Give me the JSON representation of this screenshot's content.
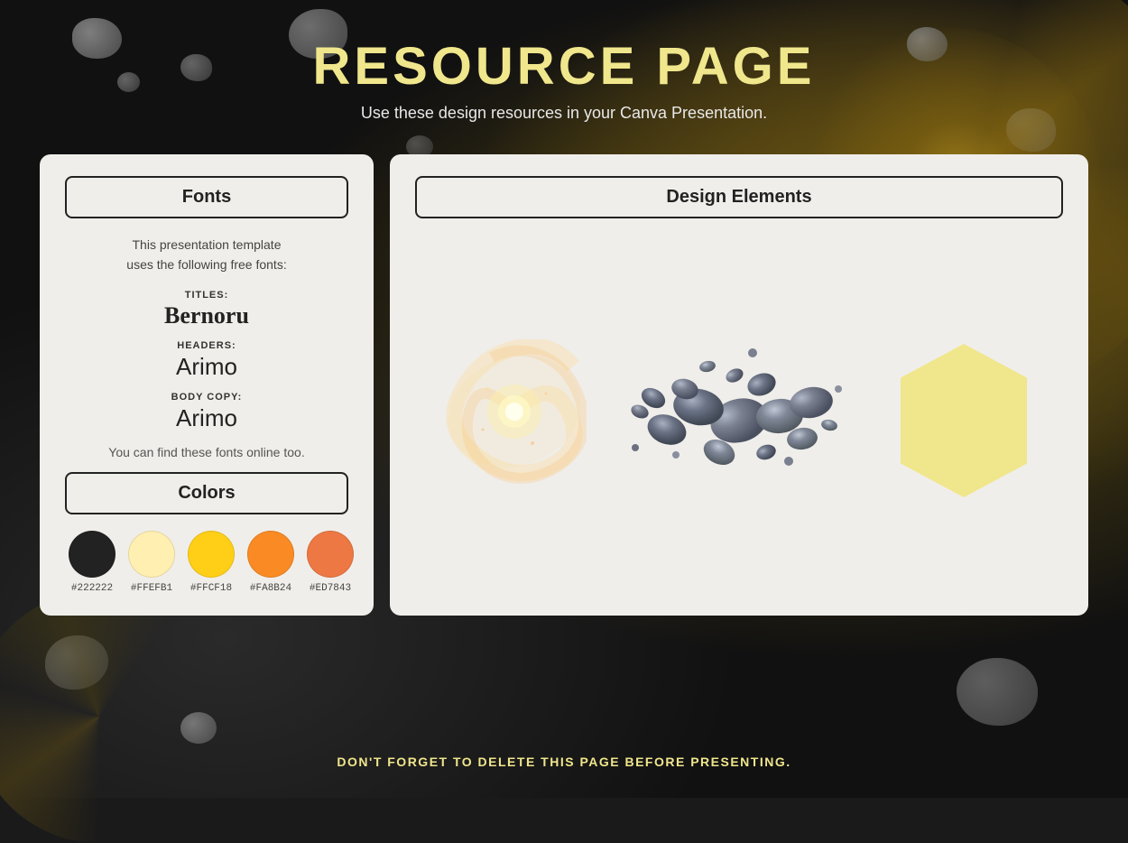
{
  "page": {
    "title": "RESOURCE PAGE",
    "subtitle": "Use these design resources in your Canva Presentation.",
    "footer": "DON'T FORGET TO DELETE THIS PAGE BEFORE PRESENTING."
  },
  "fonts_section": {
    "header": "Fonts",
    "intro_line1": "This presentation template",
    "intro_line2": "uses the following free fonts:",
    "titles_label": "TITLES:",
    "titles_font": "Bernoru",
    "headers_label": "HEADERS:",
    "headers_font": "Arimo",
    "body_label": "BODY COPY:",
    "body_font": "Arimo",
    "find_text": "You can find these fonts online too."
  },
  "colors_section": {
    "header": "Colors",
    "swatches": [
      {
        "color": "#222222",
        "hex": "#222222"
      },
      {
        "color": "#FFEFB1",
        "hex": "#FFEFB1"
      },
      {
        "color": "#FFCF18",
        "hex": "#FFCF18"
      },
      {
        "color": "#FA8B24",
        "hex": "#FA8B24"
      },
      {
        "color": "#ED7843",
        "hex": "#ED7843"
      }
    ]
  },
  "design_elements": {
    "header": "Design Elements"
  },
  "icons": {
    "galaxy": "galaxy-swirl-icon",
    "asteroids": "asteroids-cluster-icon",
    "hexagon": "hexagon-shape-icon"
  }
}
